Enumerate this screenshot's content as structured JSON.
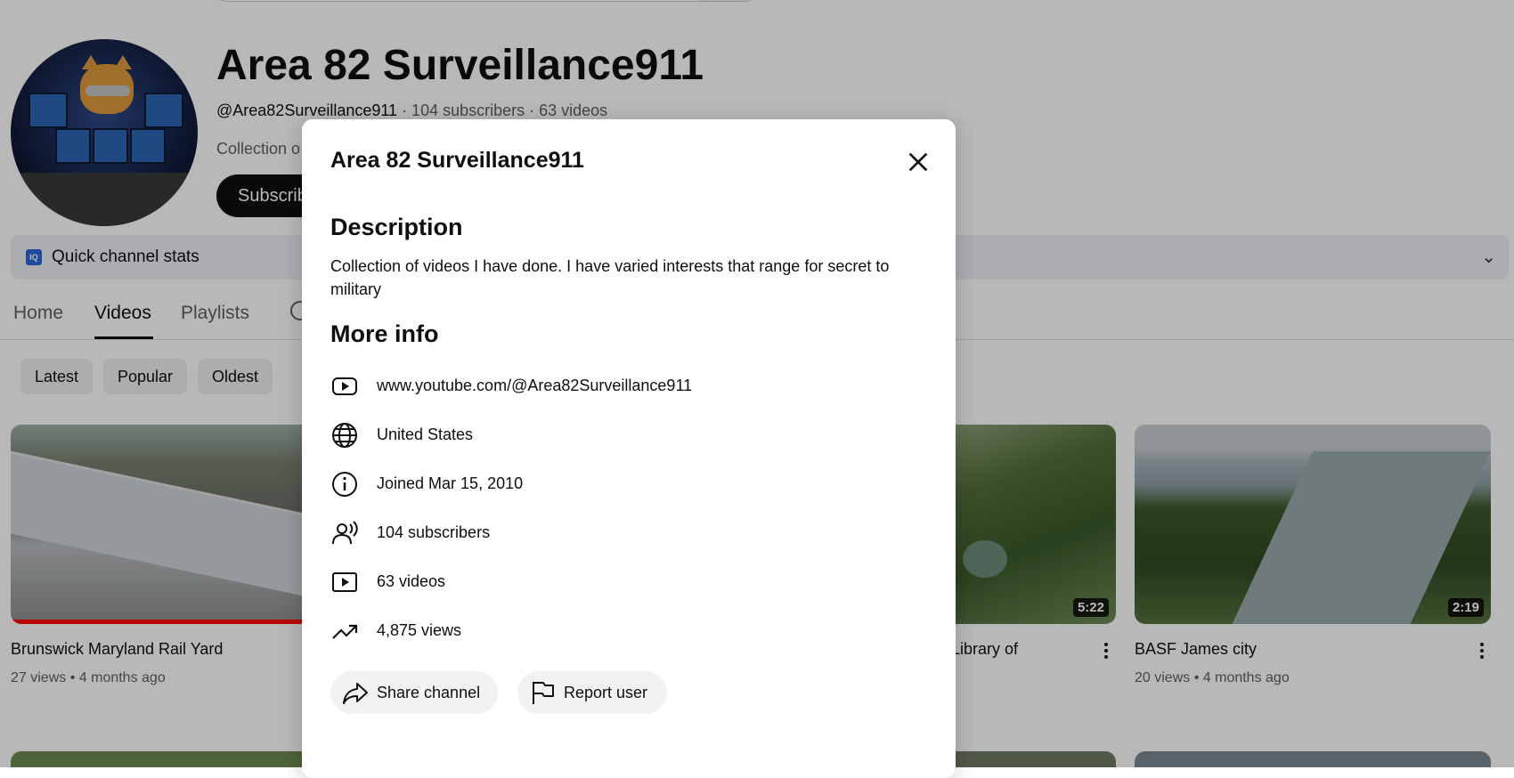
{
  "channel": {
    "name": "Area 82 Surveillance911",
    "handle": "@Area82Surveillance911",
    "meta_rest": " · 104 subscribers · 63 videos",
    "description_snippet": "Collection o",
    "subscribe_label": "Subscrib"
  },
  "stats_bar": {
    "icon_text": "IQ",
    "label": "Quick channel stats",
    "chevron": "⌄"
  },
  "tabs": [
    {
      "label": "Home"
    },
    {
      "label": "Videos"
    },
    {
      "label": "Playlists"
    }
  ],
  "chips": [
    {
      "label": "Latest"
    },
    {
      "label": "Popular"
    },
    {
      "label": "Oldest"
    }
  ],
  "videos": [
    {
      "title": "Brunswick Maryland Rail Yard",
      "views": "27 views",
      "age": "4 months ago",
      "progress": 1.0
    },
    {
      "title": "d Library of",
      "second_line": "'.",
      "duration": "5:22"
    },
    {
      "title": "BASF James city",
      "views": "20 views",
      "age": "4 months ago",
      "duration": "2:19"
    }
  ],
  "meta_separator": "•",
  "modal": {
    "title": "Area 82 Surveillance911",
    "description_heading": "Description",
    "description_text": "Collection of videos I have done. I have varied interests that range for secret to military",
    "more_info_heading": "More info",
    "info_rows": [
      {
        "icon": "youtube-play-icon",
        "text": "www.youtube.com/@Area82Surveillance911"
      },
      {
        "icon": "globe-icon",
        "text": "United States"
      },
      {
        "icon": "info-icon",
        "text": "Joined Mar 15, 2010"
      },
      {
        "icon": "subscribers-icon",
        "text": "104 subscribers"
      },
      {
        "icon": "video-icon",
        "text": "63 videos"
      },
      {
        "icon": "trending-icon",
        "text": "4,875 views"
      }
    ],
    "share_label": "Share channel",
    "report_label": "Report user"
  }
}
